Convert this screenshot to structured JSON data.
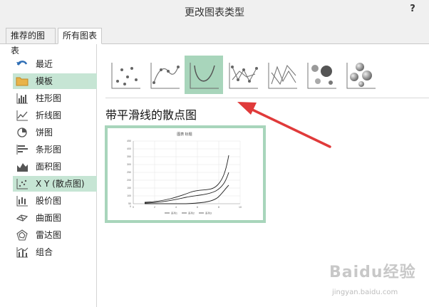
{
  "window": {
    "title": "更改图表类型",
    "help": "?"
  },
  "tabs": [
    {
      "label": "推荐的图表"
    },
    {
      "label": "所有图表"
    }
  ],
  "sidebar": {
    "items": [
      {
        "label": "最近",
        "icon": "undo-arrow-icon"
      },
      {
        "label": "模板",
        "icon": "folder-icon"
      },
      {
        "label": "柱形图",
        "icon": "column-chart-icon"
      },
      {
        "label": "折线图",
        "icon": "line-chart-icon"
      },
      {
        "label": "饼图",
        "icon": "pie-chart-icon"
      },
      {
        "label": "条形图",
        "icon": "bar-chart-icon"
      },
      {
        "label": "面积图",
        "icon": "area-chart-icon"
      },
      {
        "label": "X Y (散点图)",
        "icon": "scatter-chart-icon"
      },
      {
        "label": "股价图",
        "icon": "stock-chart-icon"
      },
      {
        "label": "曲面图",
        "icon": "surface-chart-icon"
      },
      {
        "label": "雷达图",
        "icon": "radar-chart-icon"
      },
      {
        "label": "组合",
        "icon": "combo-chart-icon"
      }
    ]
  },
  "main": {
    "subtitle": "带平滑线的散点图",
    "thumbnails": [
      "scatter-markers-icon",
      "scatter-smooth-markers-icon",
      "scatter-smooth-lines-icon",
      "scatter-straight-markers-icon",
      "scatter-straight-lines-icon",
      "bubble-icon",
      "bubble-3d-icon"
    ],
    "preview": {
      "title": "图表 标题",
      "yticks": [
        "450",
        "400",
        "350",
        "300",
        "250",
        "200",
        "150",
        "100",
        "50",
        "0"
      ],
      "xticks": [
        "0",
        "2",
        "4",
        "6",
        "8",
        "10"
      ],
      "legend": [
        "系列1",
        "系列2",
        "系列3"
      ]
    }
  },
  "watermark": {
    "brand": "Baidu经验",
    "url": "jingyan.baidu.com"
  },
  "colors": {
    "selection": "#a8d5bb",
    "active_side": "#c6e5d4",
    "arrow": "#e03a3a"
  }
}
